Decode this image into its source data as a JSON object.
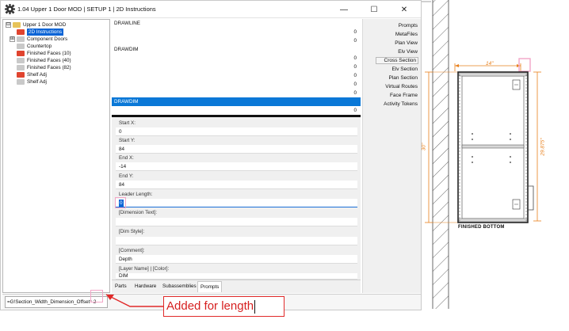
{
  "window": {
    "title": "1.04 Upper 1 Door MOD | SETUP 1 | 2D Instructions",
    "minimize": "—",
    "maximize": "☐",
    "close": "✕"
  },
  "tree": {
    "items": [
      {
        "label": "Upper 1 Door MOD",
        "toggle": "⊟"
      },
      {
        "label": "2D Instructions"
      },
      {
        "label": "Component Doors",
        "toggle": "⊞"
      },
      {
        "label": "Countertop"
      },
      {
        "label": "Finished Faces (10)"
      },
      {
        "label": "Finished Faces (40)"
      },
      {
        "label": "Finished Faces (82)"
      },
      {
        "label": "Shelf Adj"
      },
      {
        "label": "Shelf Adj"
      }
    ]
  },
  "instructions": [
    {
      "label": "DRAWLINE",
      "value": ""
    },
    {
      "label": "",
      "value": "0"
    },
    {
      "label": "",
      "value": "0"
    },
    {
      "label": "DRAWDIM",
      "value": ""
    },
    {
      "label": "",
      "value": "0"
    },
    {
      "label": "",
      "value": "0"
    },
    {
      "label": "",
      "value": "0"
    },
    {
      "label": "",
      "value": "0"
    },
    {
      "label": "",
      "value": "0"
    },
    {
      "label": "DRAWDIM",
      "value": ""
    },
    {
      "label": "",
      "value": "0"
    }
  ],
  "props": [
    {
      "label": "Start X:",
      "value": "0"
    },
    {
      "label": "Start Y:",
      "value": "84"
    },
    {
      "label": "End X:",
      "value": "-14"
    },
    {
      "label": "End Y:",
      "value": "84"
    },
    {
      "label": "Leader Length:",
      "value": "0"
    },
    {
      "label": "[Dimension Text]:",
      "value": ""
    },
    {
      "label": "[Dim Style]:",
      "value": ""
    },
    {
      "label": "[Comment]:",
      "value": "Depth"
    },
    {
      "label": "[Layer Name] | [Color]:",
      "value": "DIM"
    }
  ],
  "tabs": [
    "Parts",
    "Hardware",
    "Subassemblies",
    "Prompts"
  ],
  "commands": [
    "Prompts",
    "MetaFiles",
    "Plan View",
    "Elv View",
    "Cross Section",
    "Elv Section",
    "Plan Section",
    "Virtual Routes",
    "Face Frame",
    "Activity Tokens"
  ],
  "formula": {
    "value": "=G!Section_Width_Dimension_Offset*-2"
  },
  "annotation": {
    "text": "Added for length"
  },
  "drawing": {
    "dim_width": "14\"",
    "dim_height": "30\"",
    "dim_height_right": "29.875\"",
    "finished_bottom": "FINISHED BOTTOM"
  }
}
